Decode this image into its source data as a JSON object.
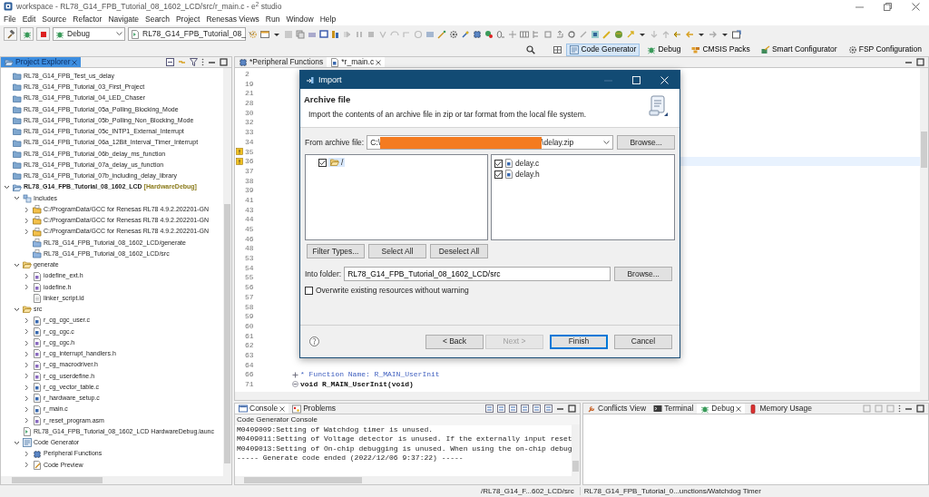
{
  "window": {
    "title": "workspace - RL78_G14_FPB_Tutorial_08_1602_LCD/src/r_main.c - e$^{2}$ studio"
  },
  "menu": [
    "File",
    "Edit",
    "Source",
    "Refactor",
    "Navigate",
    "Search",
    "Project",
    "Renesas Views",
    "Run",
    "Window",
    "Help"
  ],
  "toolbar": {
    "configuration": "Debug",
    "launch_target": "RL78_G14_FPB_Tutorial_08_"
  },
  "perspectives": [
    {
      "label": "Code Generator",
      "kind": "generator",
      "selected": true
    },
    {
      "label": "Debug",
      "kind": "debug",
      "selected": false
    },
    {
      "label": "CMSIS Packs",
      "kind": "packs",
      "selected": false
    },
    {
      "label": "Smart Configurator",
      "kind": "configurator",
      "selected": false
    },
    {
      "label": "FSP Configuration",
      "kind": "fsp",
      "selected": false
    }
  ],
  "project_explorer": {
    "title": "Project Explorer",
    "selected": true,
    "items": [
      {
        "label": "RL78_G14_FPB_Test_us_delay",
        "kind": "closed-project"
      },
      {
        "label": "RL78_G14_FPB_Tutorial_03_First_Project",
        "kind": "closed-project"
      },
      {
        "label": "RL78_G14_FPB_Tutorial_04_LED_Chaser",
        "kind": "closed-project"
      },
      {
        "label": "RL78_G14_FPB_Tutorial_05a_Polling_Blocking_Mode",
        "kind": "closed-project"
      },
      {
        "label": "RL78_G14_FPB_Tutorial_05b_Polling_Non_Blocking_Mode",
        "kind": "closed-project"
      },
      {
        "label": "RL78_G14_FPB_Tutorial_05c_INTP1_External_Interrupt",
        "kind": "closed-project"
      },
      {
        "label": "RL78_G14_FPB_Tutorial_06a_12Bit_Interval_Timer_Interrupt",
        "kind": "closed-project"
      },
      {
        "label": "RL78_G14_FPB_Tutorial_06b_delay_ms_function",
        "kind": "closed-project"
      },
      {
        "label": "RL78_G14_FPB_Tutorial_07a_delay_us_function",
        "kind": "closed-project"
      },
      {
        "label": "RL78_G14_FPB_Tutorial_07b_including_delay_library",
        "kind": "closed-project"
      },
      {
        "label": "RL78_G14_FPB_Tutorial_08_1602_LCD",
        "decoration": "[HardwareDebug]",
        "kind": "project",
        "expanded": true,
        "children": [
          {
            "label": "Includes",
            "kind": "includes",
            "expanded": true,
            "children": [
              {
                "label": "C:/ProgramData/GCC for Renesas RL78 4.9.2.202201-GN",
                "kind": "include-path",
                "expanded": false
              },
              {
                "label": "C:/ProgramData/GCC for Renesas RL78 4.9.2.202201-GN",
                "kind": "include-path",
                "expanded": false
              },
              {
                "label": "C:/ProgramData/GCC for Renesas RL78 4.9.2.202201-GN",
                "kind": "include-path",
                "expanded": false
              },
              {
                "label": "RL78_G14_FPB_Tutorial_08_1602_LCD/generate",
                "kind": "include-local"
              },
              {
                "label": "RL78_G14_FPB_Tutorial_08_1602_LCD/src",
                "kind": "include-local"
              }
            ]
          },
          {
            "label": "generate",
            "kind": "folder",
            "expanded": true,
            "children": [
              {
                "label": "iodefine_ext.h",
                "kind": "header",
                "expanded": false
              },
              {
                "label": "iodefine.h",
                "kind": "header",
                "expanded": false
              },
              {
                "label": "linker_script.ld",
                "kind": "text"
              }
            ]
          },
          {
            "label": "src",
            "kind": "folder",
            "expanded": true,
            "children": [
              {
                "label": "r_cg_cgc_user.c",
                "kind": "source",
                "expanded": false
              },
              {
                "label": "r_cg_cgc.c",
                "kind": "source",
                "expanded": false
              },
              {
                "label": "r_cg_cgc.h",
                "kind": "header",
                "expanded": false
              },
              {
                "label": "r_cg_interrupt_handlers.h",
                "kind": "header",
                "expanded": false
              },
              {
                "label": "r_cg_macrodriver.h",
                "kind": "header",
                "expanded": false
              },
              {
                "label": "r_cg_userdefine.h",
                "kind": "header",
                "expanded": false
              },
              {
                "label": "r_cg_vector_table.c",
                "kind": "source",
                "expanded": false
              },
              {
                "label": "r_hardware_setup.c",
                "kind": "source",
                "expanded": false
              },
              {
                "label": "r_main.c",
                "kind": "source",
                "expanded": false
              },
              {
                "label": "r_reset_program.asm",
                "kind": "header",
                "expanded": false
              }
            ]
          },
          {
            "label": "RL78_G14_FPB_Tutorial_08_1602_LCD HardwareDebug.launc",
            "kind": "launch"
          },
          {
            "label": "Code Generator",
            "kind": "generator",
            "expanded": true,
            "children": [
              {
                "label": "Peripheral Functions",
                "kind": "peripherals",
                "expanded": false
              },
              {
                "label": "Code Preview",
                "kind": "preview",
                "expanded": false
              }
            ]
          }
        ]
      }
    ]
  },
  "editor": {
    "tabs": [
      {
        "label": "*Peripheral Functions",
        "kind": "peripherals",
        "selected": false
      },
      {
        "label": "*r_main.c",
        "kind": "source",
        "selected": true
      }
    ],
    "lines": [
      {
        "number": "2",
        "current": false
      },
      {
        "number": "19",
        "current": false
      },
      {
        "number": "21",
        "current": false
      },
      {
        "number": "28",
        "current": false
      },
      {
        "number": "30",
        "current": false
      },
      {
        "number": "32",
        "current": false
      },
      {
        "number": "33",
        "current": false
      },
      {
        "number": "34",
        "current": false
      },
      {
        "number": "35",
        "warning": true,
        "current": false
      },
      {
        "number": "36",
        "warning": true,
        "current": true
      },
      {
        "number": "37",
        "current": false
      },
      {
        "number": "38",
        "current": false
      },
      {
        "number": "39",
        "current": false
      },
      {
        "number": "41",
        "current": false
      },
      {
        "number": "43",
        "current": false
      },
      {
        "number": "44",
        "current": false
      },
      {
        "number": "45",
        "current": false
      },
      {
        "number": "46",
        "current": false
      },
      {
        "number": "48",
        "current": false
      },
      {
        "number": "53",
        "current": false
      },
      {
        "number": "54",
        "current": false
      },
      {
        "number": "55",
        "current": false
      },
      {
        "number": "56",
        "current": false
      },
      {
        "number": "57",
        "current": false
      },
      {
        "number": "58",
        "current": false
      },
      {
        "number": "59",
        "current": false
      },
      {
        "number": "60",
        "current": false
      },
      {
        "number": "61",
        "current": false
      },
      {
        "number": "62",
        "current": false
      },
      {
        "number": "63",
        "current": false
      },
      {
        "number": "64",
        "current": false
      },
      {
        "number": "66",
        "folded": true,
        "kind": "comment",
        "code": "* Function Name: R_MAIN_UserInit",
        "current": false
      },
      {
        "number": "71",
        "folded": false,
        "kind": "code",
        "code": "void R_MAIN_UserInit(void)",
        "current": false
      }
    ]
  },
  "console": {
    "tabs": [
      {
        "label": "Console",
        "kind": "console",
        "selected": true
      },
      {
        "label": "Problems",
        "kind": "problems",
        "selected": false
      }
    ],
    "title": "Code Generator Console",
    "lines": [
      "M0409009:Setting of Watchdog timer is unused.",
      "M0409011:Setting of Voltage detector is unused. If the externally input reset",
      "M0409013:Setting of On-chip debugging is unused. When using the on-chip debug",
      "----- Generate code ended (2022/12/06 9:37:22) -----"
    ]
  },
  "views": {
    "tabs": [
      {
        "label": "Conflicts View",
        "kind": "conflicts",
        "selected": false
      },
      {
        "label": "Terminal",
        "kind": "terminal",
        "selected": false
      },
      {
        "label": "Debug",
        "kind": "debug",
        "selected": true
      },
      {
        "label": "Memory Usage",
        "kind": "memory",
        "selected": false
      }
    ]
  },
  "status_bar": [
    "/RL78_G14_F...602_LCD/src",
    "RL78_G14_FPB_Tutorial_0...unctions/Watchdog Timer"
  ],
  "dialog": {
    "title": "Import",
    "heading": "Archive file",
    "description": "Import the contents of an archive file in zip or tar format from the local file system.",
    "from_label": "From archive file:",
    "archive_path": {
      "prefix": "C:\\",
      "redacted": true,
      "suffix": "\\delay.zip"
    },
    "browse": "Browse...",
    "folders": [
      {
        "label": "/",
        "checked": true,
        "selected": true
      }
    ],
    "files": [
      {
        "label": "delay.c",
        "checked": true
      },
      {
        "label": "delay.h",
        "checked": true
      }
    ],
    "selection_buttons": [
      "Filter Types...",
      "Select All",
      "Deselect All"
    ],
    "into_label": "Into folder:",
    "into_value": "RL78_G14_FPB_Tutorial_08_1602_LCD/src",
    "into_browse": "Browse...",
    "overwrite": {
      "label": "Overwrite existing resources without warning",
      "checked": false
    },
    "footer_buttons": [
      {
        "label": "< Back",
        "disabled": false,
        "default": false
      },
      {
        "label": "Next >",
        "disabled": true,
        "default": false
      },
      {
        "label": "Finish",
        "disabled": false,
        "default": true
      },
      {
        "label": "Cancel",
        "disabled": false,
        "default": false
      }
    ]
  }
}
